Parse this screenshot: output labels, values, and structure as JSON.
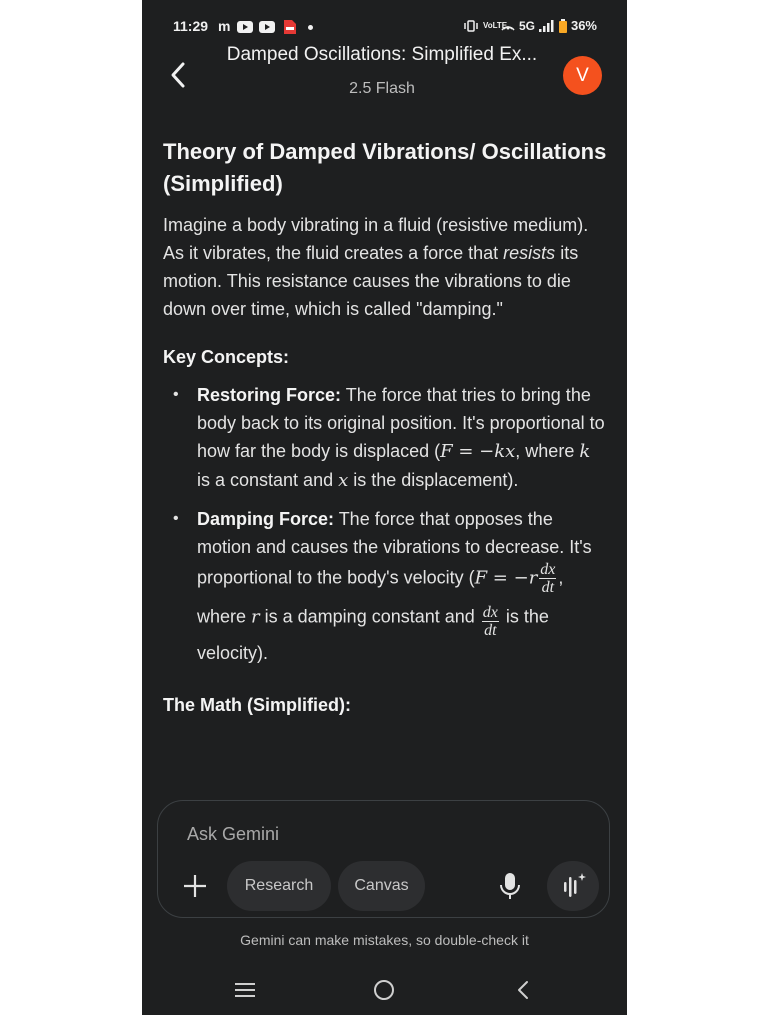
{
  "status_bar": {
    "time": "11:29",
    "carrier_glyph": "m",
    "notifications": [
      "youtube-icon",
      "youtube-icon",
      "pdf-icon",
      "dot-icon"
    ],
    "network": "5G",
    "volte": "VoLTE",
    "battery": "36%"
  },
  "header": {
    "title": "Damped Oscillations: Simplified Ex...",
    "model": "2.5 Flash",
    "avatar_letter": "V",
    "avatar_color": "#f4511e"
  },
  "content": {
    "heading": "Theory of Damped Vibrations/ Oscillations (Simplified)",
    "intro": {
      "part1": "Imagine a body vibrating in a fluid (resistive medium). As it vibrates, the fluid creates a force that ",
      "emphasis": "resists",
      "part2": " its motion. This resistance causes the vibrations to die down over time, which is called \"damping.\""
    },
    "key_concepts_title": "Key Concepts:",
    "concepts": [
      {
        "term": "Restoring Force:",
        "text1": " The force that tries to bring the body back to its original position. It's proportional to how far the body is displaced (",
        "formula": "F = −kx",
        "text2": ", where ",
        "var1": "k",
        "text3": " is a constant and ",
        "var2": "x",
        "text4": " is the displacement)."
      },
      {
        "term": "Damping Force:",
        "text1": " The force that opposes the motion and causes the vibrations to decrease. It's proportional to the body's velocity (",
        "formula_lhs": "F = −r",
        "frac_num": "dx",
        "frac_den": "dt",
        "text2": ", where ",
        "var1": "r",
        "text3": " is a damping constant and ",
        "text4": " is the velocity)."
      }
    ],
    "math_title": "The Math (Simplified):"
  },
  "input": {
    "placeholder": "Ask Gemini",
    "chip_research": "Research",
    "chip_canvas": "Canvas"
  },
  "disclaimer": "Gemini can make mistakes, so double-check it"
}
